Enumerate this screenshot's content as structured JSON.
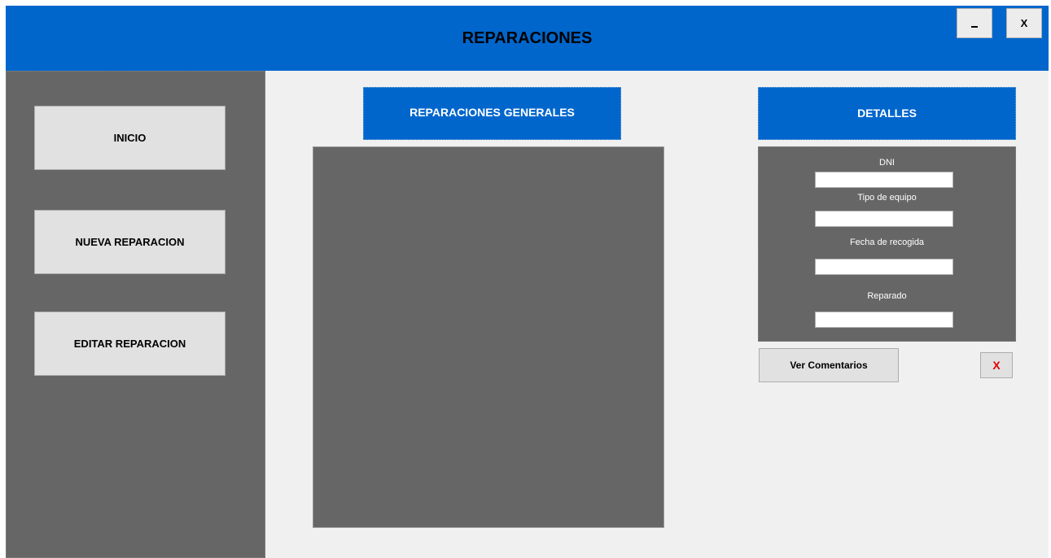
{
  "window": {
    "title": "REPARACIONES",
    "minimize_label": "_",
    "close_label": "X"
  },
  "sidebar": {
    "items": [
      {
        "label": "INICIO"
      },
      {
        "label": "NUEVA REPARACION"
      },
      {
        "label": "EDITAR REPARACION"
      }
    ]
  },
  "main": {
    "general_header": "REPARACIONES GENERALES",
    "list_items": []
  },
  "details": {
    "header": "DETALLES",
    "fields": [
      {
        "label": "DNI",
        "value": ""
      },
      {
        "label": "Tipo de equipo",
        "value": ""
      },
      {
        "label": "Fecha de recogida",
        "value": ""
      },
      {
        "label": "Reparado",
        "value": ""
      }
    ],
    "view_comments_label": "Ver Comentarios",
    "delete_label": "X"
  },
  "colors": {
    "accent_blue": "#0066cc",
    "panel_gray": "#666666",
    "window_bg": "#f0f0f0",
    "delete_red": "#e00000"
  }
}
